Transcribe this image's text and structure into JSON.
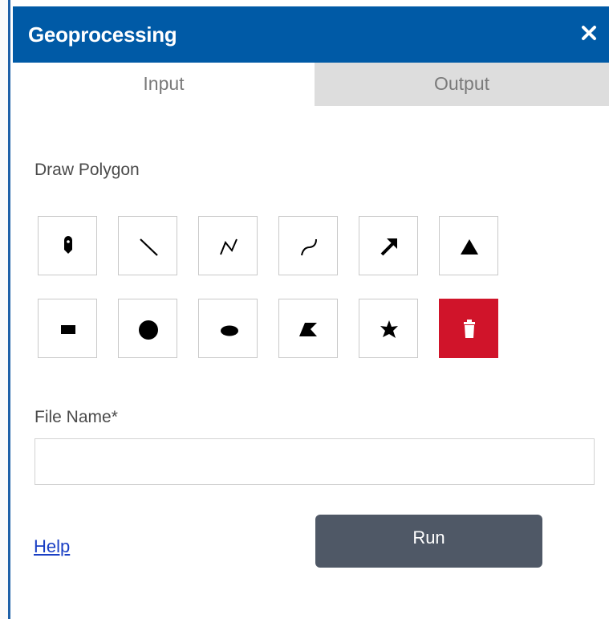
{
  "header": {
    "title": "Geoprocessing",
    "close_icon": "close-icon"
  },
  "tabs": [
    {
      "label": "Input",
      "active": true
    },
    {
      "label": "Output",
      "active": false
    }
  ],
  "draw": {
    "label": "Draw Polygon",
    "tools": [
      {
        "name": "point",
        "icon": "map-pin-icon"
      },
      {
        "name": "line",
        "icon": "line-icon"
      },
      {
        "name": "polyline",
        "icon": "polyline-icon"
      },
      {
        "name": "freehand-polyline",
        "icon": "freehand-line-icon"
      },
      {
        "name": "arrow",
        "icon": "arrow-icon"
      },
      {
        "name": "triangle",
        "icon": "triangle-icon"
      },
      {
        "name": "rectangle",
        "icon": "rectangle-icon"
      },
      {
        "name": "circle",
        "icon": "circle-icon"
      },
      {
        "name": "ellipse",
        "icon": "ellipse-icon"
      },
      {
        "name": "polygon",
        "icon": "polygon-icon"
      },
      {
        "name": "freehand-polygon",
        "icon": "freehand-polygon-icon"
      },
      {
        "name": "delete",
        "icon": "trash-icon"
      }
    ]
  },
  "file": {
    "label": "File Name*",
    "value": "",
    "placeholder": ""
  },
  "footer": {
    "help_label": "Help",
    "run_label": "Run"
  },
  "colors": {
    "header_bg": "#005aa6",
    "delete_bg": "#d0142a",
    "run_bg": "#4f5866",
    "link": "#1a3fc4"
  }
}
